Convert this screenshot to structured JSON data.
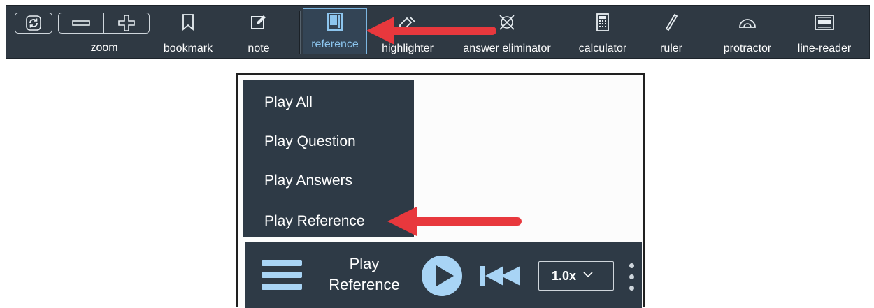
{
  "toolbar": {
    "zoom_label": "zoom",
    "tools": [
      {
        "label": "bookmark",
        "icon": "bookmark-icon"
      },
      {
        "label": "note",
        "icon": "note-icon"
      },
      {
        "label": "reference",
        "icon": "reference-icon",
        "active": true
      },
      {
        "label": "highlighter",
        "icon": "highlighter-icon"
      },
      {
        "label": "answer eliminator",
        "icon": "answer-eliminator-icon"
      },
      {
        "label": "calculator",
        "icon": "calculator-icon"
      },
      {
        "label": "ruler",
        "icon": "ruler-icon"
      },
      {
        "label": "protractor",
        "icon": "protractor-icon"
      },
      {
        "label": "line-reader",
        "icon": "line-reader-icon"
      }
    ]
  },
  "menu": {
    "items": [
      "Play All",
      "Play Question",
      "Play Answers",
      "Play Reference"
    ]
  },
  "player": {
    "title_line1": "Play",
    "title_line2": "Reference",
    "speed": "1.0x"
  },
  "colors": {
    "toolbar_bg": "#2f3943",
    "panel_bg": "#2e3a46",
    "accent_blue": "#a8d4f5",
    "annotation_red": "#e8383d"
  }
}
